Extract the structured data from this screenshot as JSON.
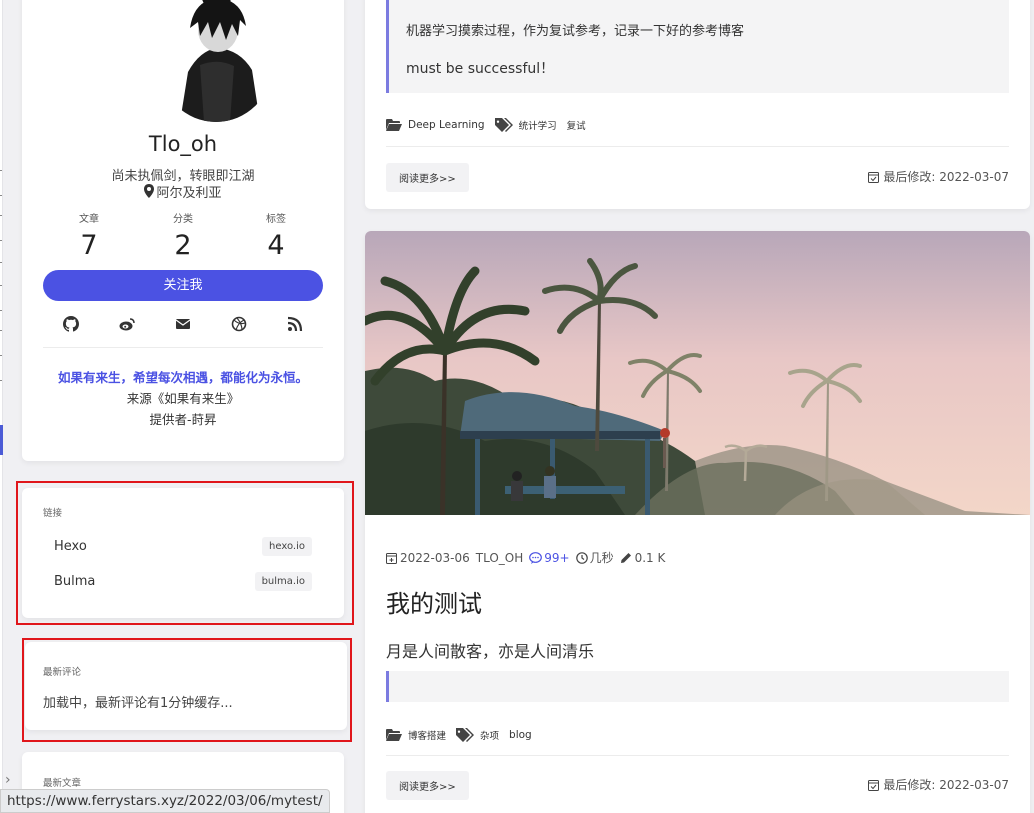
{
  "profile": {
    "name": "Tlo_oh",
    "title": "尚未执佩剑，转眼即江湖",
    "location": "阿尔及利亚",
    "stats": [
      {
        "label": "文章",
        "value": "7"
      },
      {
        "label": "分类",
        "value": "2"
      },
      {
        "label": "标签",
        "value": "4"
      }
    ],
    "follow_label": "关注我",
    "social_icons": [
      "github-icon",
      "weibo-icon",
      "email-icon",
      "dribbble-icon",
      "rss-icon"
    ],
    "quote": "如果有来生，希望每次相遇，都能化为永恒。",
    "quote_source": "来源《如果有来生》",
    "quote_by": "提供者-莳昇"
  },
  "links_widget": {
    "title": "链接",
    "items": [
      {
        "name": "Hexo",
        "tag": "hexo.io"
      },
      {
        "name": "Bulma",
        "tag": "bulma.io"
      }
    ]
  },
  "comments_widget": {
    "title": "最新评论",
    "loading": "加载中，最新评论有1分钟缓存..."
  },
  "latest_widget": {
    "title": "最新文章"
  },
  "status_url": "https://www.ferrystars.xyz/2022/03/06/mytest/",
  "post1": {
    "quote_line1": "机器学习摸索过程，作为复试参考，记录一下好的参考博客",
    "quote_line2": "must be successful！",
    "category": "Deep Learning",
    "tags": [
      "统计学习",
      "复试"
    ],
    "read_more": "阅读更多>>",
    "modified": "最后修改: 2022-03-07"
  },
  "post2": {
    "date": "2022-03-06",
    "author": "TLO_OH",
    "comments": "99+",
    "read_time": "几秒",
    "words": "0.1 K",
    "title": "我的测试",
    "excerpt": "月是人间散客，亦是人间清乐",
    "category": "博客搭建",
    "tags": [
      "杂项",
      "blog"
    ],
    "read_more": "阅读更多>>",
    "modified": "最后修改: 2022-03-07"
  },
  "colors": {
    "accent": "#4b52e3",
    "highlight_box": "#e0161b",
    "blockquote_border": "#7b7be0"
  }
}
